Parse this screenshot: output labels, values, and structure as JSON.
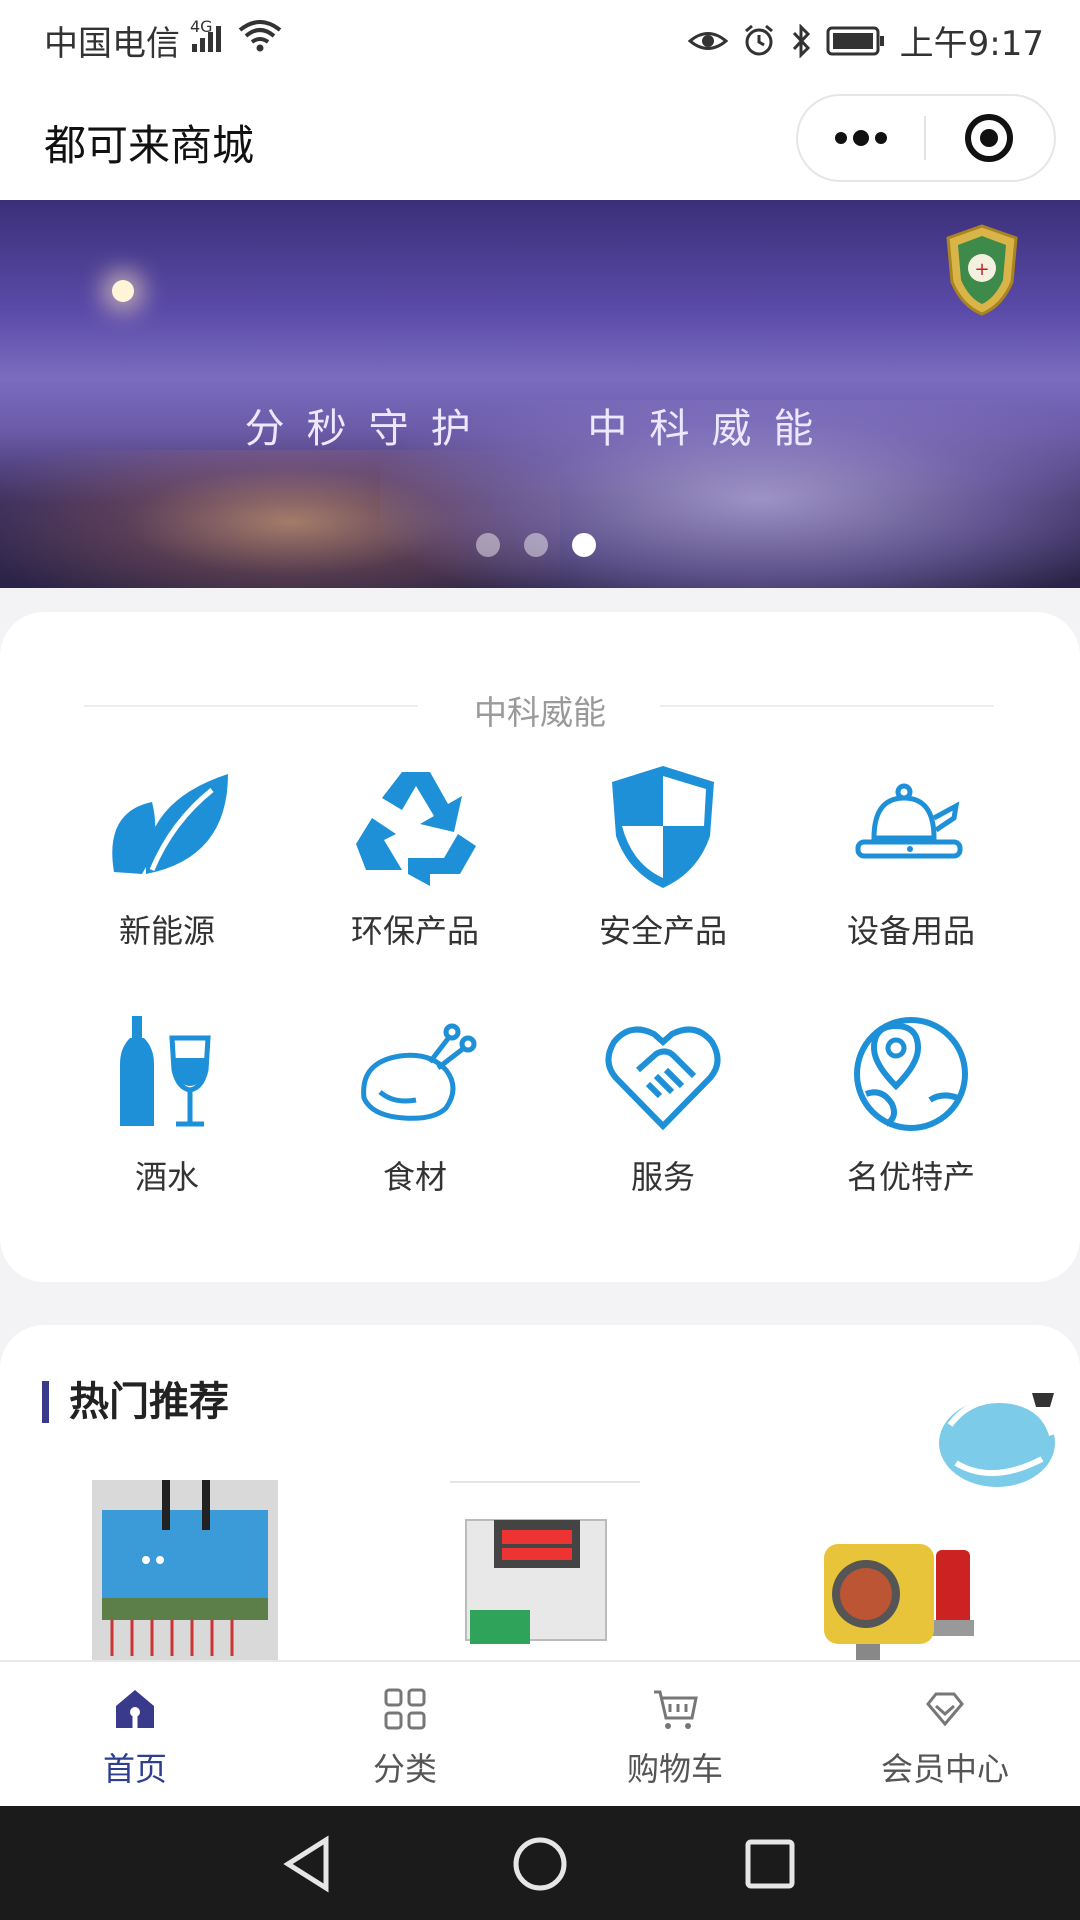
{
  "status_bar": {
    "carrier": "中国电信",
    "network": "4G",
    "time": "上午9:17"
  },
  "title_bar": {
    "title": "都可来商城",
    "more_icon": "more-dots-icon",
    "close_icon": "target-close-icon"
  },
  "banner": {
    "slogan_left": "分秒守护",
    "slogan_right": "中科威能",
    "slide_count": 3,
    "active_slide": 3
  },
  "category_section": {
    "title": "中科威能",
    "accent_color": "#1e90d8",
    "items": [
      {
        "label": "新能源",
        "icon": "leaf-icon"
      },
      {
        "label": "环保产品",
        "icon": "recycle-icon"
      },
      {
        "label": "安全产品",
        "icon": "shield-icon"
      },
      {
        "label": "设备用品",
        "icon": "kettle-stove-icon"
      },
      {
        "label": "酒水",
        "icon": "wine-bottle-glass-icon"
      },
      {
        "label": "食材",
        "icon": "roast-chicken-icon"
      },
      {
        "label": "服务",
        "icon": "handshake-heart-icon"
      },
      {
        "label": "名优特产",
        "icon": "map-pin-globe-icon"
      }
    ]
  },
  "hot_section": {
    "title": "热门推荐",
    "badge_icon": "prize-quiz-badge-icon"
  },
  "tab_bar": {
    "active_color": "#2f3f8f",
    "items": [
      {
        "label": "首页",
        "icon": "home-icon"
      },
      {
        "label": "分类",
        "icon": "grid-icon"
      },
      {
        "label": "购物车",
        "icon": "cart-icon"
      },
      {
        "label": "会员中心",
        "icon": "diamond-icon"
      }
    ]
  }
}
